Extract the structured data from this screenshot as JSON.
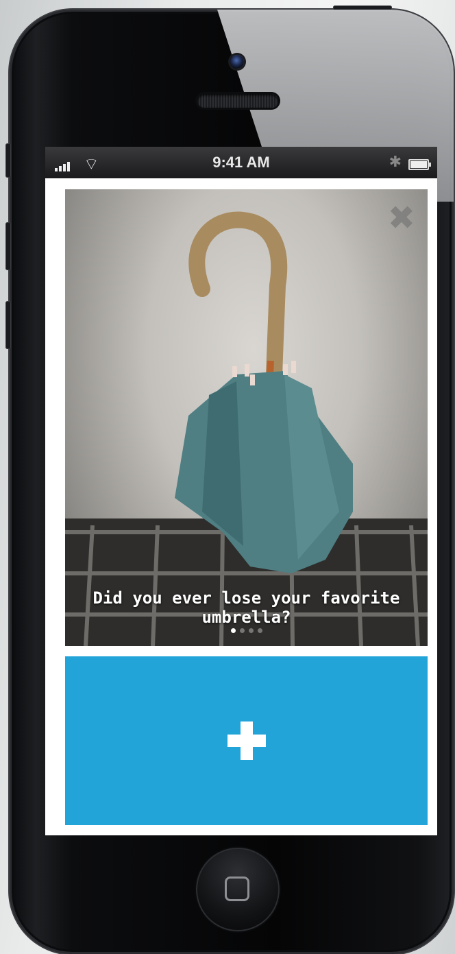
{
  "status_bar": {
    "time": "9:41 AM"
  },
  "card": {
    "caption": "Did you ever lose your favorite umbrella?",
    "page_count": 4,
    "active_page": 1
  },
  "icons": {
    "close": "close-icon",
    "add": "plus-icon",
    "signal": "signal-icon",
    "wifi": "wifi-icon",
    "bluetooth": "bluetooth-icon",
    "battery": "battery-icon"
  },
  "colors": {
    "accent": "#22a4d9"
  }
}
